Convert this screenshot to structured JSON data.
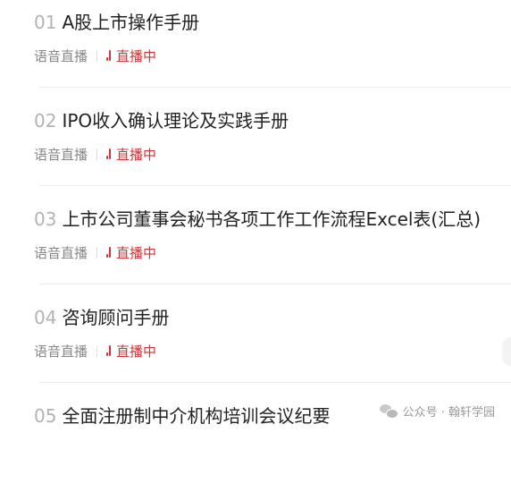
{
  "items": [
    {
      "index": "01",
      "title": "A股上市操作手册",
      "type": "语音直播",
      "status": "直播中"
    },
    {
      "index": "02",
      "title": "IPO收入确认理论及实践手册",
      "type": "语音直播",
      "status": "直播中"
    },
    {
      "index": "03",
      "title": "上市公司董事会秘书各项工作工作流程Excel表(汇总)",
      "type": "语音直播",
      "status": "直播中"
    },
    {
      "index": "04",
      "title": "咨询顾问手册",
      "type": "语音直播",
      "status": "直播中"
    },
    {
      "index": "05",
      "title": "全面注册制中介机构培训会议纪要"
    }
  ],
  "watermark": {
    "icon": "wechat-icon",
    "text": "公众号 · 翰轩学园"
  },
  "colors": {
    "index": "#b3b3b3",
    "title": "#222222",
    "meta": "#888888",
    "live": "#d0343a",
    "divider": "#ececec"
  }
}
